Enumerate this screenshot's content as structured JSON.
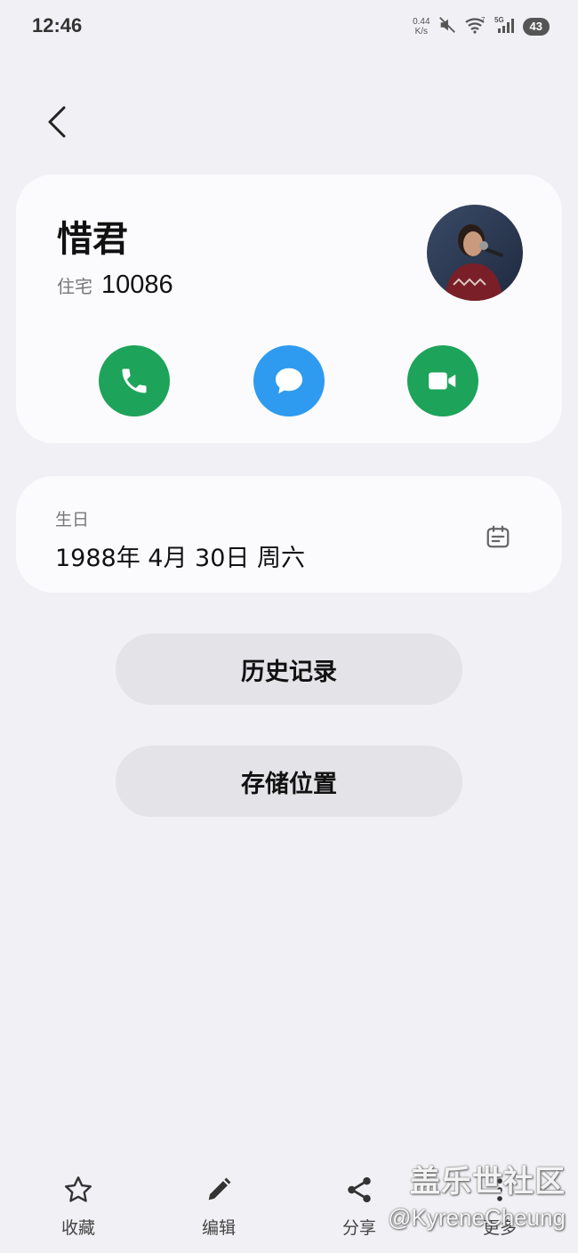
{
  "status_bar": {
    "time": "12:46",
    "net_speed_value": "0.44",
    "net_speed_unit": "K/s",
    "battery": "43",
    "icons": [
      "mute-icon",
      "wifi-icon",
      "signal-5g-icon"
    ]
  },
  "contact": {
    "name": "惜君",
    "phone_label": "住宅",
    "phone_number": "10086",
    "actions": [
      "phone-icon",
      "message-icon",
      "video-icon"
    ]
  },
  "birthday": {
    "label": "生日",
    "value": "1988年 4月 30日 周六",
    "icon": "calendar-icon"
  },
  "buttons": {
    "history": "历史记录",
    "storage": "存储位置"
  },
  "bottom_nav": {
    "favorite": "收藏",
    "edit": "编辑",
    "share": "分享",
    "more": "更多"
  },
  "watermark": {
    "line1": "盖乐世社区",
    "line2": "@KyreneCheung"
  },
  "colors": {
    "background": "#f1f1f5",
    "card": "#fbfbfe",
    "call_green": "#1ea35a",
    "message_blue": "#2e9bf0",
    "pill_gray": "#e4e4e8"
  }
}
